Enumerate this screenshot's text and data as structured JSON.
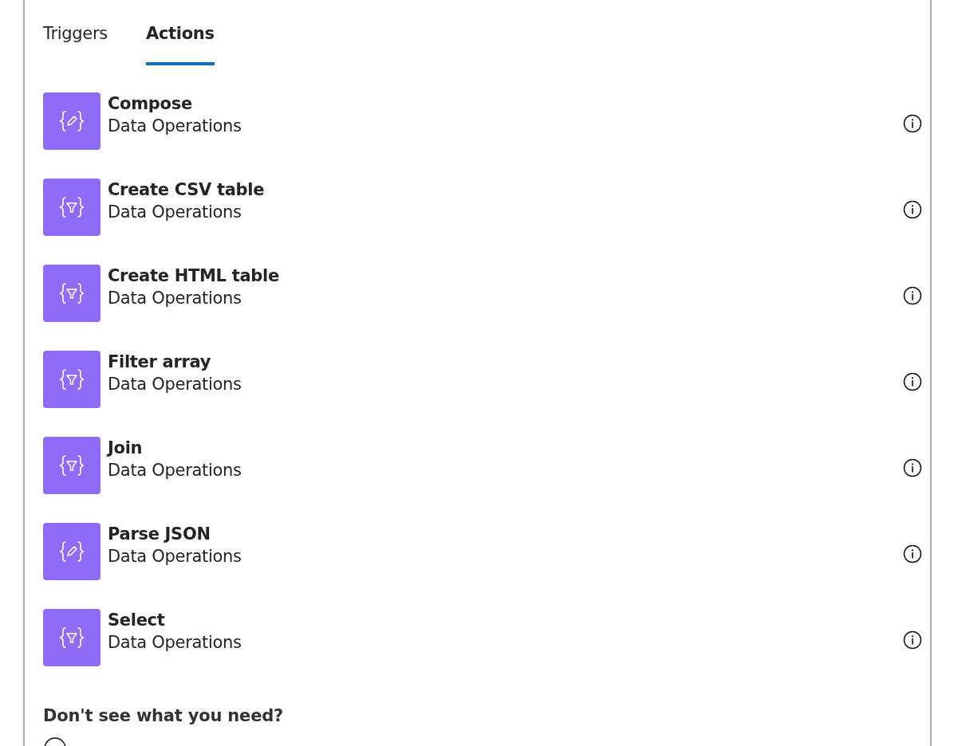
{
  "tabs": [
    {
      "label": "Triggers",
      "selected": false
    },
    {
      "label": "Actions",
      "selected": true
    }
  ],
  "actions": [
    {
      "title": "Compose",
      "subtitle": "Data Operations",
      "kind": "edit"
    },
    {
      "title": "Create CSV table",
      "subtitle": "Data Operations",
      "kind": "filter"
    },
    {
      "title": "Create HTML table",
      "subtitle": "Data Operations",
      "kind": "filter"
    },
    {
      "title": "Filter array",
      "subtitle": "Data Operations",
      "kind": "filter"
    },
    {
      "title": "Join",
      "subtitle": "Data Operations",
      "kind": "filter"
    },
    {
      "title": "Parse JSON",
      "subtitle": "Data Operations",
      "kind": "edit"
    },
    {
      "title": "Select",
      "subtitle": "Data Operations",
      "kind": "filter"
    }
  ],
  "footer": {
    "heading": "Don't see what you need?"
  }
}
